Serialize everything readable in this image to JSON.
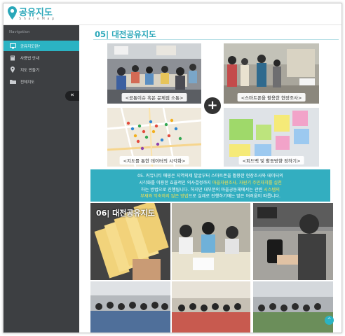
{
  "app": {
    "logo_title": "공유지도",
    "logo_subtitle": "S h a r e  M a p",
    "brand_color": "#2aa7b9"
  },
  "sidebar": {
    "header": "Navigation",
    "items": [
      {
        "label": "공유지도란?",
        "icon": "monitor-icon",
        "active": true
      },
      {
        "label": "사용법 안내",
        "icon": "book-icon",
        "active": false
      },
      {
        "label": "지도 만들기",
        "icon": "map-pin-icon",
        "active": false
      },
      {
        "label": "전체지도",
        "icon": "folder-icon",
        "active": false
      }
    ],
    "collapse_label": "«"
  },
  "main": {
    "section_title": "05| 대전공유지도",
    "captions": [
      "<공통이슈 혹은 문제점 소통>",
      "<스마트폰을 활용한 현장조사>",
      "<지도를 통한 데이터의 시각화>",
      "<피드백 및 활동방향 정하기>"
    ],
    "plus_symbol": "+",
    "info": {
      "line1": "05. 커뮤니티 매핑은 지역의제 발굴부터 스마트폰을 활용한 현장조사와 데이터의",
      "line2_pre": "시각화를 이용한 효율적인 의사결정까지 ",
      "line2_hl": "마을자원조사, 자원기 주민자치를 실천",
      "line3_pre": "하는 방법으로 진행됩니다. 하지만 대부분의 마을공동체에서는 관련 ",
      "line3_hl": "시스템의",
      "line4_hl": "부재와 익숙하지 않은 방법",
      "line4_post": "으로 실제로 진행하기에는 많은 어려움이 따릅니다."
    },
    "banner_title": "06| 대전공유지도",
    "scroll_top_label": "^"
  }
}
